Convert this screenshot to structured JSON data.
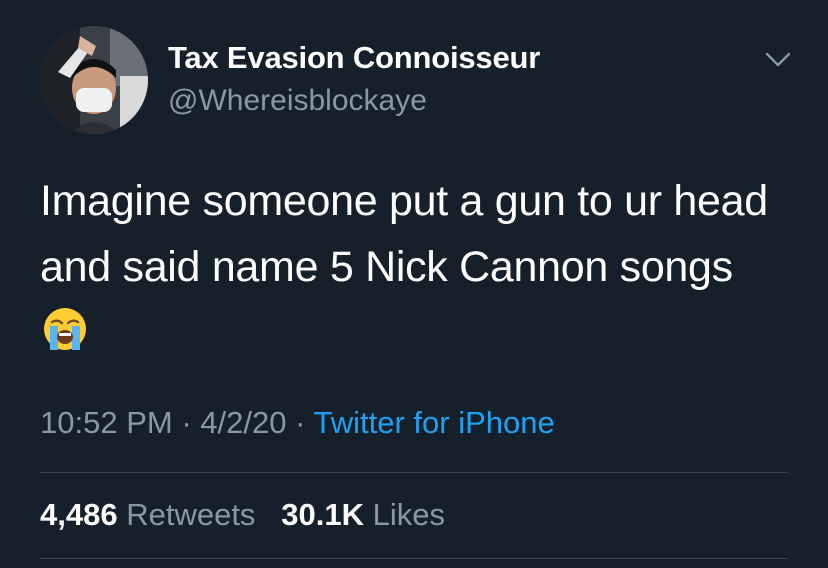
{
  "user": {
    "display_name": "Tax Evasion Connoisseur",
    "handle": "@Whereisblockaye",
    "avatar_icon": "profile-photo"
  },
  "menu": {
    "icon": "chevron-down-icon"
  },
  "tweet": {
    "lines": [
      "Imagine someone put a gun to ur head",
      "and said name 5 Nick Cannon songs"
    ],
    "emoji": "loudly-crying-face"
  },
  "meta": {
    "time": "10:52 PM",
    "separator": "·",
    "date": "4/2/20",
    "source": "Twitter for iPhone"
  },
  "stats": {
    "retweets_count": "4,486",
    "retweets_label": "Retweets",
    "likes_count": "30.1K",
    "likes_label": "Likes"
  },
  "colors": {
    "background": "#15202b",
    "secondary_text": "#8899a6",
    "link": "#1da1f2",
    "divider": "#38444d"
  }
}
